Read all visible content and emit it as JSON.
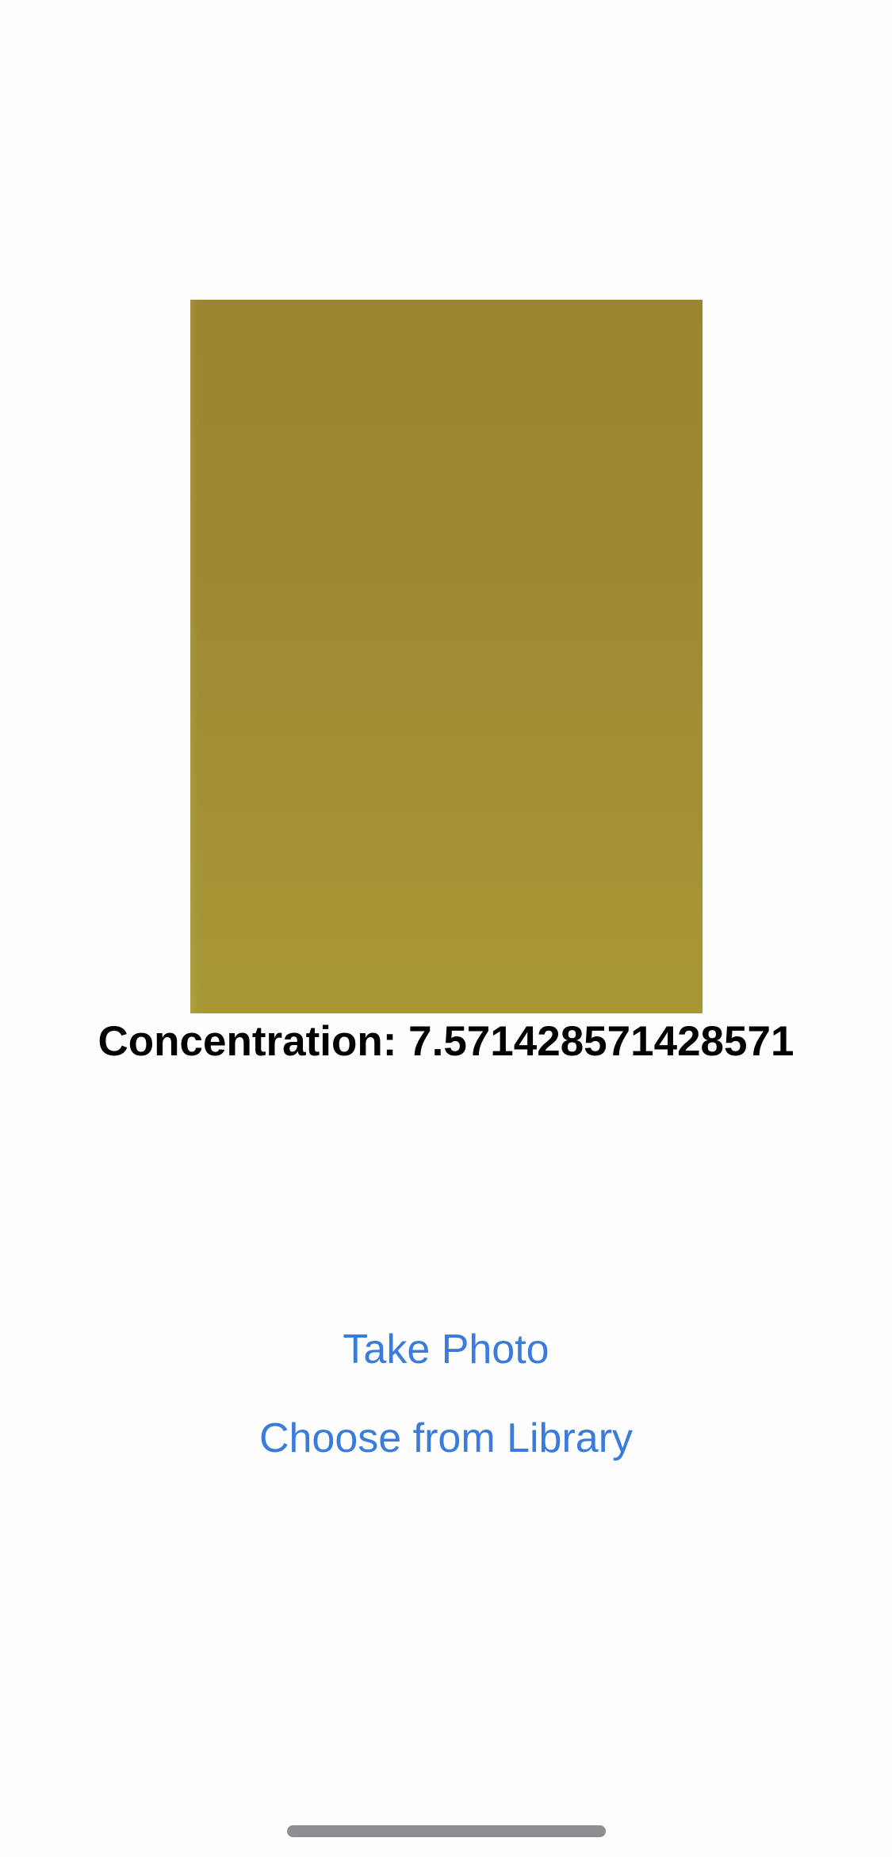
{
  "result": {
    "concentration_label": "Concentration: 7.571428571428571"
  },
  "photo": {
    "swatch_color": "#A08A31"
  },
  "actions": {
    "take_photo_label": "Take Photo",
    "choose_library_label": "Choose from Library",
    "accent_color": "#3A7BDB"
  }
}
